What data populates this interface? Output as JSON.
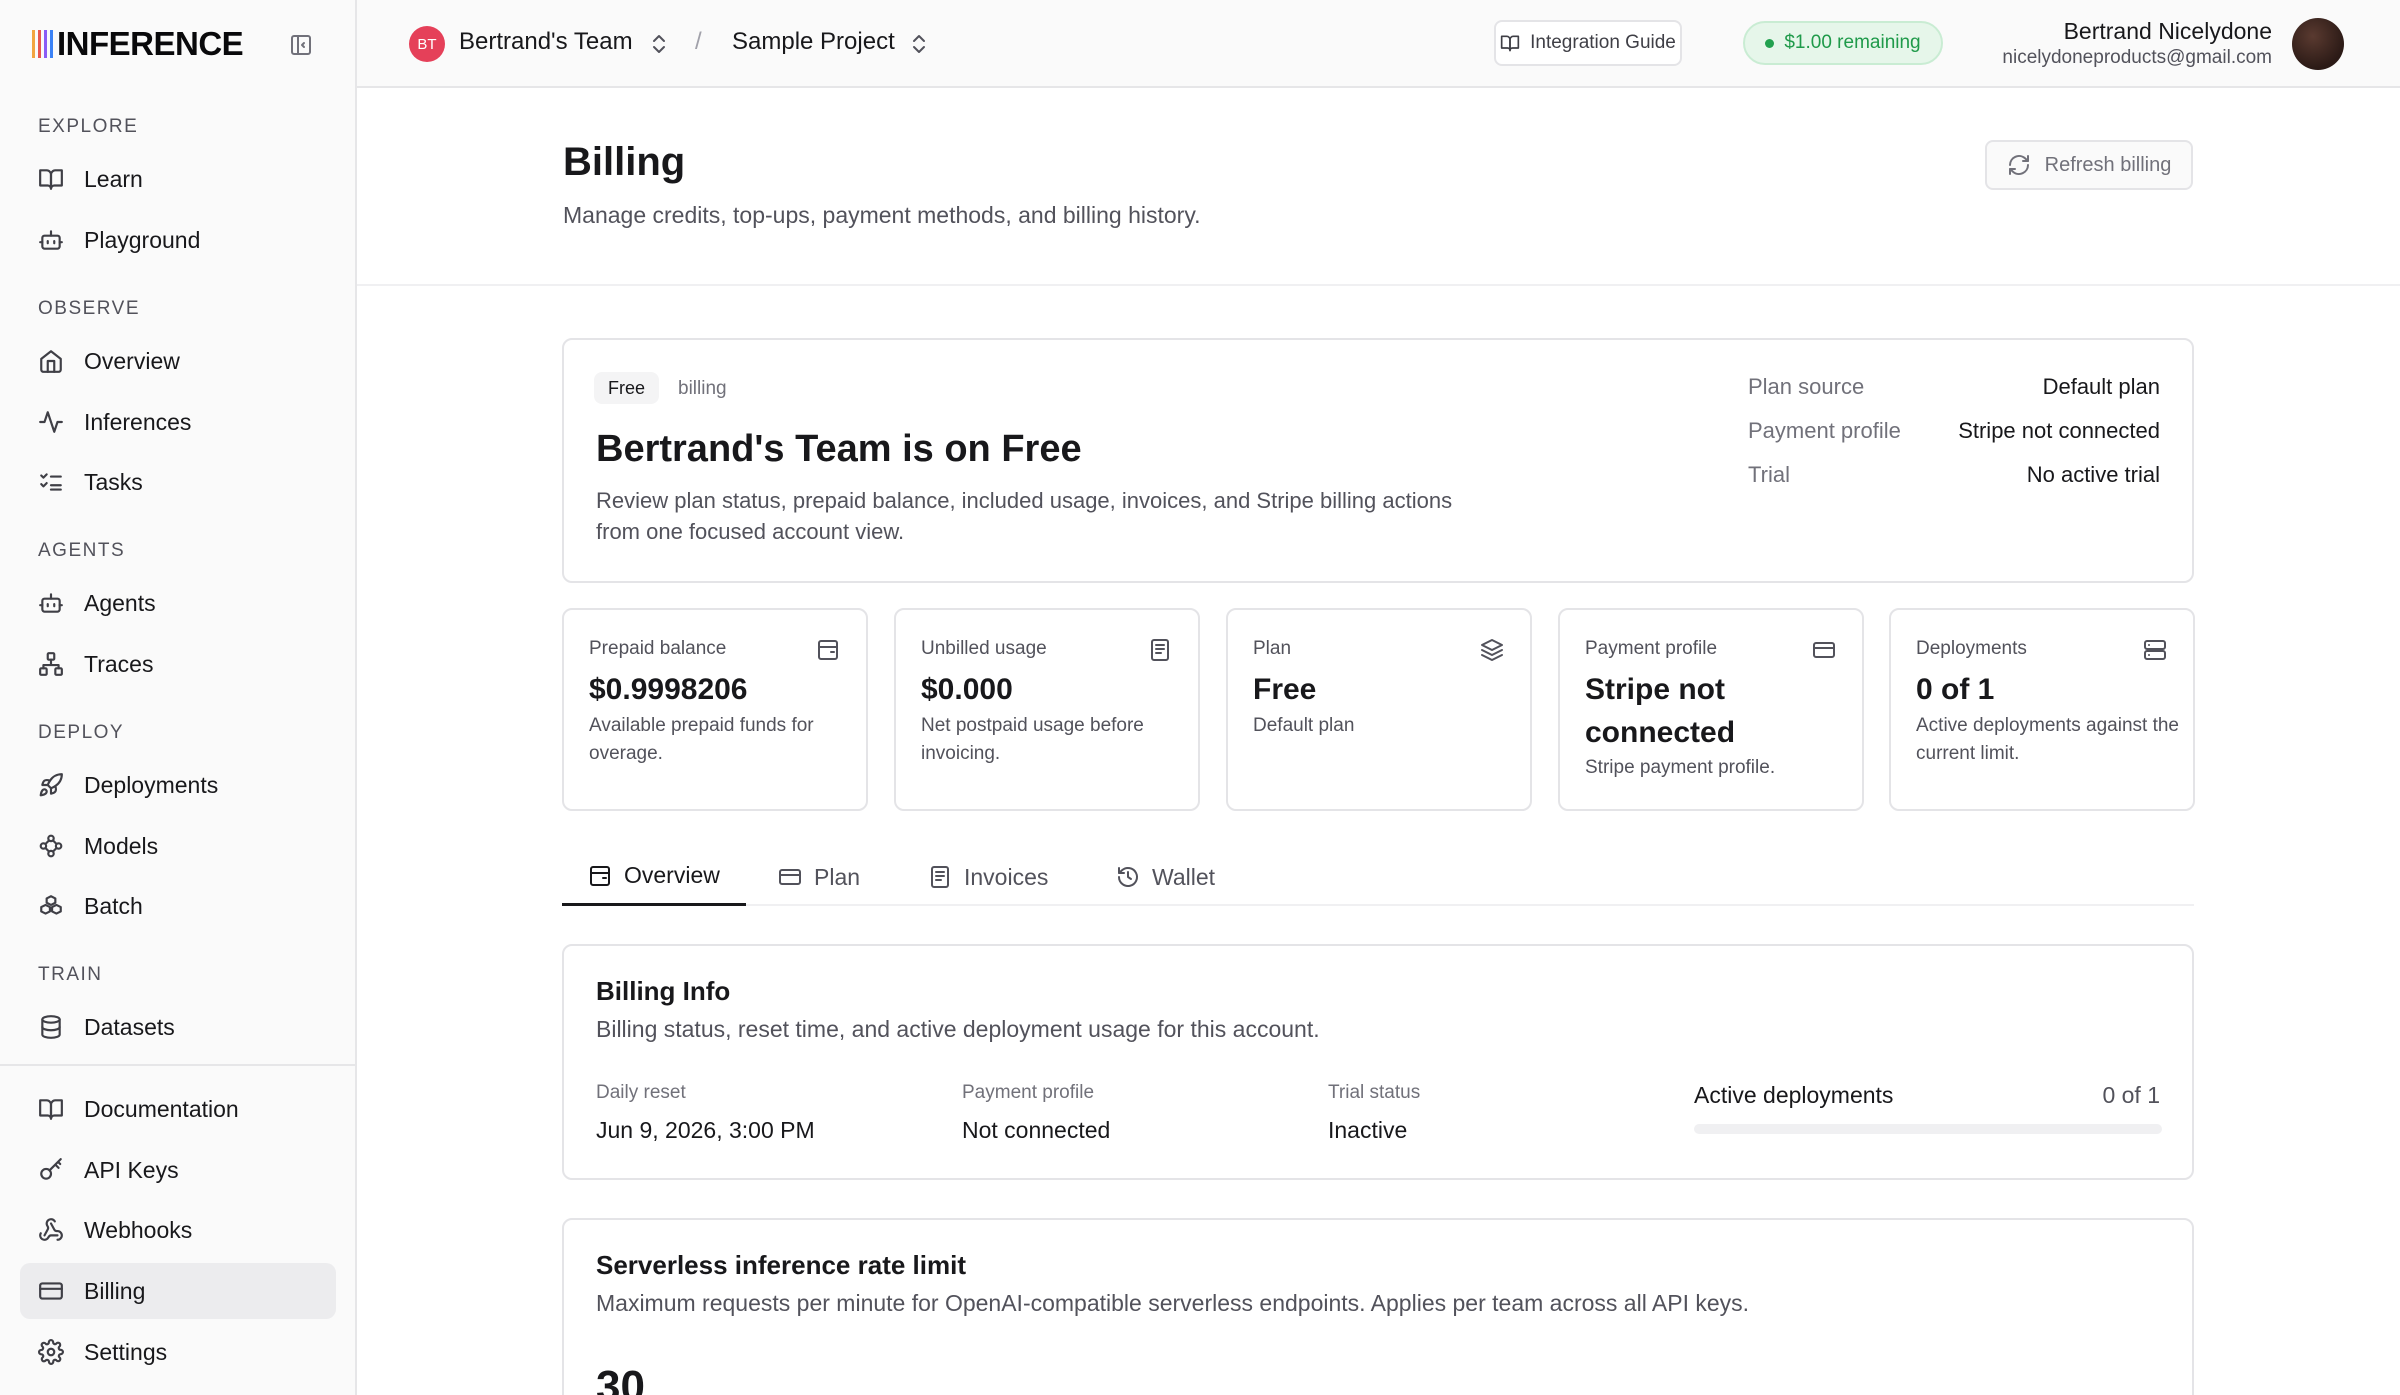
{
  "app": {
    "brand": "INFERENCE",
    "brand_bar_colors": [
      "#f2a541",
      "#e7574f",
      "#8b5cf6",
      "#3b82f6"
    ]
  },
  "sidebar": {
    "sections": [
      {
        "label": "EXPLORE"
      },
      {
        "label": "OBSERVE"
      },
      {
        "label": "AGENTS"
      },
      {
        "label": "DEPLOY"
      },
      {
        "label": "TRAIN"
      }
    ],
    "items": [
      {
        "label": "Learn",
        "icon": "book-icon"
      },
      {
        "label": "Playground",
        "icon": "bot-icon"
      },
      {
        "label": "Overview",
        "icon": "home-icon"
      },
      {
        "label": "Inferences",
        "icon": "activity-icon"
      },
      {
        "label": "Tasks",
        "icon": "list-checks-icon"
      },
      {
        "label": "Agents",
        "icon": "bot-icon"
      },
      {
        "label": "Traces",
        "icon": "network-icon"
      },
      {
        "label": "Deployments",
        "icon": "rocket-icon"
      },
      {
        "label": "Models",
        "icon": "nodes-icon"
      },
      {
        "label": "Batch",
        "icon": "boxes-icon"
      },
      {
        "label": "Datasets",
        "icon": "database-icon"
      },
      {
        "label": "Documentation",
        "icon": "book-icon"
      },
      {
        "label": "API Keys",
        "icon": "key-icon"
      },
      {
        "label": "Webhooks",
        "icon": "webhook-icon"
      },
      {
        "label": "Billing",
        "icon": "credit-card-icon",
        "active": true
      },
      {
        "label": "Settings",
        "icon": "gear-icon"
      }
    ]
  },
  "topbar": {
    "team_initials": "BT",
    "team_name": "Bertrand's Team",
    "separator": "/",
    "project_name": "Sample Project",
    "guide_label": "Integration Guide",
    "credit_label": "$1.00 remaining",
    "user_name": "Bertrand Nicelydone",
    "user_email": "nicelydoneproducts@gmail.com"
  },
  "header": {
    "title": "Billing",
    "subtitle": "Manage credits, top-ups, payment methods, and billing history.",
    "refresh_label": "Refresh billing"
  },
  "hero": {
    "tag": "Free",
    "tag_secondary": "billing",
    "title": "Bertrand's Team is on Free",
    "description": "Review plan status, prepaid balance, included usage, invoices, and Stripe billing actions from one focused account view.",
    "details": [
      {
        "label": "Plan source",
        "value": "Default plan"
      },
      {
        "label": "Payment profile",
        "value": "Stripe not connected"
      },
      {
        "label": "Trial",
        "value": "No active trial"
      }
    ]
  },
  "stats": [
    {
      "label": "Prepaid balance",
      "value": "$0.9998206",
      "desc": "Available prepaid funds for overage.",
      "icon": "wallet-icon"
    },
    {
      "label": "Unbilled usage",
      "value": "$0.000",
      "desc": "Net postpaid usage before invoicing.",
      "icon": "receipt-icon"
    },
    {
      "label": "Plan",
      "value": "Free",
      "desc": "Default plan",
      "icon": "layers-icon"
    },
    {
      "label": "Payment profile",
      "value": "Stripe not connected",
      "desc": "Stripe payment profile.",
      "icon": "credit-card-icon"
    },
    {
      "label": "Deployments",
      "value": "0 of 1",
      "desc": "Active deployments against the current limit.",
      "icon": "server-icon"
    }
  ],
  "tabs": [
    {
      "label": "Overview",
      "icon": "wallet-icon",
      "active": true
    },
    {
      "label": "Plan",
      "icon": "credit-card-icon"
    },
    {
      "label": "Invoices",
      "icon": "receipt-icon"
    },
    {
      "label": "Wallet",
      "icon": "history-icon"
    }
  ],
  "billing_info": {
    "title": "Billing Info",
    "subtitle": "Billing status, reset time, and active deployment usage for this account.",
    "fields": [
      {
        "label": "Daily reset",
        "value": "Jun 9, 2026, 3:00 PM"
      },
      {
        "label": "Payment profile",
        "value": "Not connected"
      },
      {
        "label": "Trial status",
        "value": "Inactive"
      }
    ],
    "deployments_label": "Active deployments",
    "deployments_value": "0 of 1",
    "deployments_fraction": 0
  },
  "rate_limit": {
    "title": "Serverless inference rate limit",
    "subtitle": "Maximum requests per minute for OpenAI-compatible serverless endpoints. Applies per team across all API keys.",
    "value": "30"
  }
}
